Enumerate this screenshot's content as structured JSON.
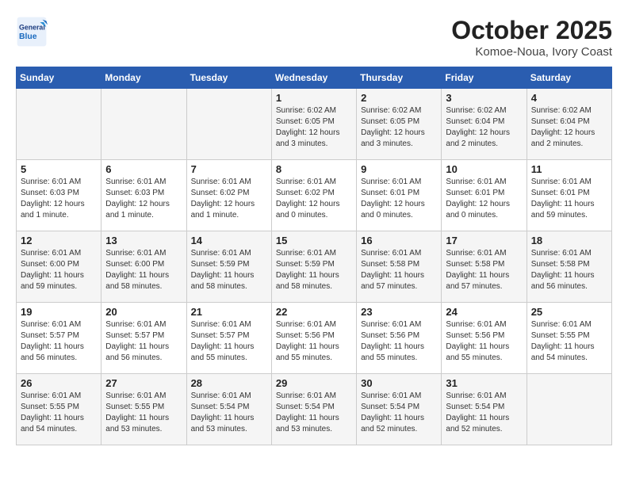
{
  "logo": {
    "general": "General",
    "blue": "Blue"
  },
  "header": {
    "month": "October 2025",
    "location": "Komoe-Noua, Ivory Coast"
  },
  "weekdays": [
    "Sunday",
    "Monday",
    "Tuesday",
    "Wednesday",
    "Thursday",
    "Friday",
    "Saturday"
  ],
  "weeks": [
    [
      {
        "day": "",
        "info": ""
      },
      {
        "day": "",
        "info": ""
      },
      {
        "day": "",
        "info": ""
      },
      {
        "day": "1",
        "info": "Sunrise: 6:02 AM\nSunset: 6:05 PM\nDaylight: 12 hours\nand 3 minutes."
      },
      {
        "day": "2",
        "info": "Sunrise: 6:02 AM\nSunset: 6:05 PM\nDaylight: 12 hours\nand 3 minutes."
      },
      {
        "day": "3",
        "info": "Sunrise: 6:02 AM\nSunset: 6:04 PM\nDaylight: 12 hours\nand 2 minutes."
      },
      {
        "day": "4",
        "info": "Sunrise: 6:02 AM\nSunset: 6:04 PM\nDaylight: 12 hours\nand 2 minutes."
      }
    ],
    [
      {
        "day": "5",
        "info": "Sunrise: 6:01 AM\nSunset: 6:03 PM\nDaylight: 12 hours\nand 1 minute."
      },
      {
        "day": "6",
        "info": "Sunrise: 6:01 AM\nSunset: 6:03 PM\nDaylight: 12 hours\nand 1 minute."
      },
      {
        "day": "7",
        "info": "Sunrise: 6:01 AM\nSunset: 6:02 PM\nDaylight: 12 hours\nand 1 minute."
      },
      {
        "day": "8",
        "info": "Sunrise: 6:01 AM\nSunset: 6:02 PM\nDaylight: 12 hours\nand 0 minutes."
      },
      {
        "day": "9",
        "info": "Sunrise: 6:01 AM\nSunset: 6:01 PM\nDaylight: 12 hours\nand 0 minutes."
      },
      {
        "day": "10",
        "info": "Sunrise: 6:01 AM\nSunset: 6:01 PM\nDaylight: 12 hours\nand 0 minutes."
      },
      {
        "day": "11",
        "info": "Sunrise: 6:01 AM\nSunset: 6:01 PM\nDaylight: 11 hours\nand 59 minutes."
      }
    ],
    [
      {
        "day": "12",
        "info": "Sunrise: 6:01 AM\nSunset: 6:00 PM\nDaylight: 11 hours\nand 59 minutes."
      },
      {
        "day": "13",
        "info": "Sunrise: 6:01 AM\nSunset: 6:00 PM\nDaylight: 11 hours\nand 58 minutes."
      },
      {
        "day": "14",
        "info": "Sunrise: 6:01 AM\nSunset: 5:59 PM\nDaylight: 11 hours\nand 58 minutes."
      },
      {
        "day": "15",
        "info": "Sunrise: 6:01 AM\nSunset: 5:59 PM\nDaylight: 11 hours\nand 58 minutes."
      },
      {
        "day": "16",
        "info": "Sunrise: 6:01 AM\nSunset: 5:58 PM\nDaylight: 11 hours\nand 57 minutes."
      },
      {
        "day": "17",
        "info": "Sunrise: 6:01 AM\nSunset: 5:58 PM\nDaylight: 11 hours\nand 57 minutes."
      },
      {
        "day": "18",
        "info": "Sunrise: 6:01 AM\nSunset: 5:58 PM\nDaylight: 11 hours\nand 56 minutes."
      }
    ],
    [
      {
        "day": "19",
        "info": "Sunrise: 6:01 AM\nSunset: 5:57 PM\nDaylight: 11 hours\nand 56 minutes."
      },
      {
        "day": "20",
        "info": "Sunrise: 6:01 AM\nSunset: 5:57 PM\nDaylight: 11 hours\nand 56 minutes."
      },
      {
        "day": "21",
        "info": "Sunrise: 6:01 AM\nSunset: 5:57 PM\nDaylight: 11 hours\nand 55 minutes."
      },
      {
        "day": "22",
        "info": "Sunrise: 6:01 AM\nSunset: 5:56 PM\nDaylight: 11 hours\nand 55 minutes."
      },
      {
        "day": "23",
        "info": "Sunrise: 6:01 AM\nSunset: 5:56 PM\nDaylight: 11 hours\nand 55 minutes."
      },
      {
        "day": "24",
        "info": "Sunrise: 6:01 AM\nSunset: 5:56 PM\nDaylight: 11 hours\nand 55 minutes."
      },
      {
        "day": "25",
        "info": "Sunrise: 6:01 AM\nSunset: 5:55 PM\nDaylight: 11 hours\nand 54 minutes."
      }
    ],
    [
      {
        "day": "26",
        "info": "Sunrise: 6:01 AM\nSunset: 5:55 PM\nDaylight: 11 hours\nand 54 minutes."
      },
      {
        "day": "27",
        "info": "Sunrise: 6:01 AM\nSunset: 5:55 PM\nDaylight: 11 hours\nand 53 minutes."
      },
      {
        "day": "28",
        "info": "Sunrise: 6:01 AM\nSunset: 5:54 PM\nDaylight: 11 hours\nand 53 minutes."
      },
      {
        "day": "29",
        "info": "Sunrise: 6:01 AM\nSunset: 5:54 PM\nDaylight: 11 hours\nand 53 minutes."
      },
      {
        "day": "30",
        "info": "Sunrise: 6:01 AM\nSunset: 5:54 PM\nDaylight: 11 hours\nand 52 minutes."
      },
      {
        "day": "31",
        "info": "Sunrise: 6:01 AM\nSunset: 5:54 PM\nDaylight: 11 hours\nand 52 minutes."
      },
      {
        "day": "",
        "info": ""
      }
    ]
  ]
}
